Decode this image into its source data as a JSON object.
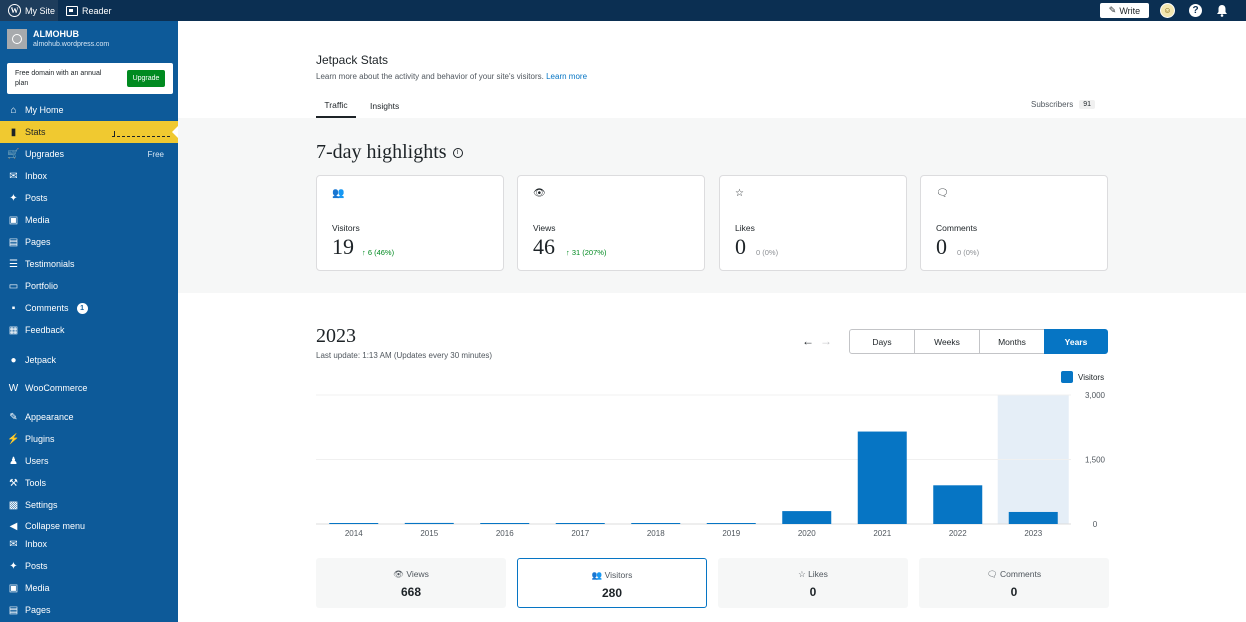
{
  "adminbar": {
    "my_site": "My Site",
    "reader": "Reader",
    "write": "Write",
    "help": "?"
  },
  "sidebar": {
    "site_name": "ALMOHUB",
    "site_url": "almohub.wordpress.com",
    "upgrade_text": "Free domain with an annual plan",
    "upgrade_button": "Upgrade",
    "items": [
      {
        "label": "My Home",
        "icon": "home-icon"
      },
      {
        "label": "Stats",
        "icon": "stats-icon",
        "active": true
      },
      {
        "label": "Upgrades",
        "icon": "cart-icon",
        "tag": "Free"
      },
      {
        "label": "Inbox",
        "icon": "mail-icon"
      },
      {
        "label": "Posts",
        "icon": "pin-icon"
      },
      {
        "label": "Media",
        "icon": "media-icon"
      },
      {
        "label": "Pages",
        "icon": "pages-icon"
      },
      {
        "label": "Testimonials",
        "icon": "testimonial-icon"
      },
      {
        "label": "Portfolio",
        "icon": "portfolio-icon"
      },
      {
        "label": "Comments",
        "icon": "comment-icon",
        "count": "1"
      },
      {
        "label": "Feedback",
        "icon": "feedback-icon"
      },
      {
        "label": "Jetpack",
        "icon": "jetpack-icon"
      },
      {
        "label": "WooCommerce",
        "icon": "woo-icon"
      },
      {
        "label": "Appearance",
        "icon": "brush-icon"
      },
      {
        "label": "Plugins",
        "icon": "plugin-icon"
      },
      {
        "label": "Users",
        "icon": "user-icon"
      },
      {
        "label": "Tools",
        "icon": "wrench-icon"
      },
      {
        "label": "Settings",
        "icon": "settings-icon"
      },
      {
        "label": "Collapse menu",
        "icon": "collapse-icon"
      },
      {
        "label": "Inbox",
        "icon": "mail-icon"
      },
      {
        "label": "Posts",
        "icon": "pin-icon"
      },
      {
        "label": "Media",
        "icon": "media-icon"
      },
      {
        "label": "Pages",
        "icon": "pages-icon"
      }
    ]
  },
  "header": {
    "title": "Jetpack Stats",
    "subtitle": "Learn more about the activity and behavior of your site's visitors.",
    "learn_more": "Learn more",
    "tabs": [
      "Traffic",
      "Insights"
    ],
    "subscribers_label": "Subscribers",
    "subscribers_count": "91"
  },
  "highlights": {
    "title": "7-day highlights",
    "cards": [
      {
        "label": "Visitors",
        "value": "19",
        "delta": "↑ 6 (46%)",
        "trend": "up",
        "icon": "visitors-icon"
      },
      {
        "label": "Views",
        "value": "46",
        "delta": "↑ 31 (207%)",
        "trend": "up",
        "icon": "eye-icon"
      },
      {
        "label": "Likes",
        "value": "0",
        "delta": "0 (0%)",
        "trend": "flat",
        "icon": "star-icon"
      },
      {
        "label": "Comments",
        "value": "0",
        "delta": "0 (0%)",
        "trend": "flat",
        "icon": "comment-icon"
      }
    ]
  },
  "period": {
    "year": "2023",
    "last_update": "Last update: 1:13 AM (Updates every 30 minutes)",
    "segments": [
      "Days",
      "Weeks",
      "Months",
      "Years"
    ],
    "selected": "Years"
  },
  "chart_data": {
    "type": "bar",
    "categories": [
      "2014",
      "2015",
      "2016",
      "2017",
      "2018",
      "2019",
      "2020",
      "2021",
      "2022",
      "2023"
    ],
    "series": [
      {
        "name": "Visitors",
        "values": [
          20,
          25,
          15,
          0,
          5,
          5,
          300,
          2150,
          900,
          280
        ]
      }
    ],
    "ylim": [
      0,
      3000
    ],
    "yticks": [
      "3,000",
      "1,500",
      "0"
    ],
    "highlight_category": "2023",
    "bar_color": "#0675c4",
    "legend_position": "top-right"
  },
  "totals": [
    {
      "label": "Views",
      "value": "668",
      "icon": "eye-icon"
    },
    {
      "label": "Visitors",
      "value": "280",
      "icon": "visitors-icon",
      "selected": true
    },
    {
      "label": "Likes",
      "value": "0",
      "icon": "star-icon"
    },
    {
      "label": "Comments",
      "value": "0",
      "icon": "comment-icon"
    }
  ],
  "colors": {
    "sidebar": "#0d5a99",
    "adminbar": "#0b2f52",
    "accent": "#0675c4",
    "active_menu": "#f0c930",
    "upgrade": "#008a20"
  }
}
